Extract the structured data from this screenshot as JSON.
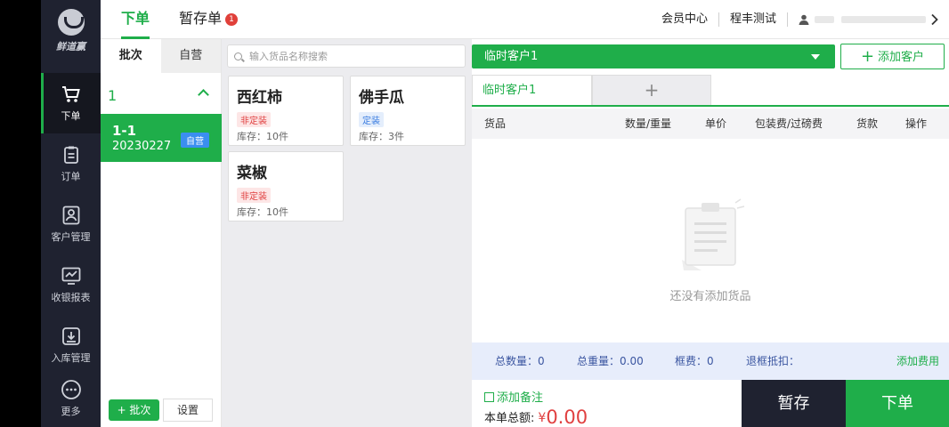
{
  "brand": {
    "name": "鲜道赢"
  },
  "nav": {
    "items": [
      {
        "label": "下单",
        "icon": "cart-icon"
      },
      {
        "label": "订单",
        "icon": "clipboard-icon"
      },
      {
        "label": "客户管理",
        "icon": "customer-icon"
      },
      {
        "label": "收银报表",
        "icon": "report-icon"
      },
      {
        "label": "入库管理",
        "icon": "inbound-icon"
      },
      {
        "label": "更多",
        "icon": "more-icon"
      }
    ]
  },
  "header": {
    "tab_order": "下单",
    "tab_draft": "暂存单",
    "draft_badge": "1",
    "member_center": "会员中心",
    "account_name": "程丰测试"
  },
  "batch_panel": {
    "tab_batch": "批次",
    "tab_self": "自营",
    "group_label": "1",
    "item": {
      "code": "1-1",
      "date": "20230227",
      "tag": "自营"
    },
    "add_batch": "+ 批次",
    "settings": "设置"
  },
  "goods": {
    "search_placeholder": "输入货品名称搜索",
    "items": [
      {
        "name": "西红柿",
        "tag": "非定装",
        "stock": "库存：10件"
      },
      {
        "name": "佛手瓜",
        "tag": "定装",
        "stock": "库存：3件"
      },
      {
        "name": "菜椒",
        "tag": "非定装",
        "stock": "库存：10件"
      }
    ]
  },
  "order": {
    "customer_select": "临时客户1",
    "add_customer": "添加客户",
    "customer_tab": "临时客户1",
    "add_tab": "+",
    "columns": [
      "货品",
      "数量/重量",
      "单价",
      "包装费/过磅费",
      "货款",
      "操作"
    ],
    "empty_text": "还没有添加货品",
    "totals": {
      "qty": "总数量：0",
      "weight": "总重量：0.00",
      "frame_fee": "框费：0",
      "frame_return": "退框抵扣：",
      "add_fee": "添加费用"
    },
    "add_remark": "添加备注",
    "total_label": "本单总额:",
    "currency": "¥",
    "total_amount": "0.00",
    "hold_button": "暂存",
    "submit_button": "下单"
  },
  "colors": {
    "accent": "#1fae4a",
    "nav_bg": "#1f2230",
    "alert": "#e04040",
    "tag_blue": "#3b8ef0"
  }
}
